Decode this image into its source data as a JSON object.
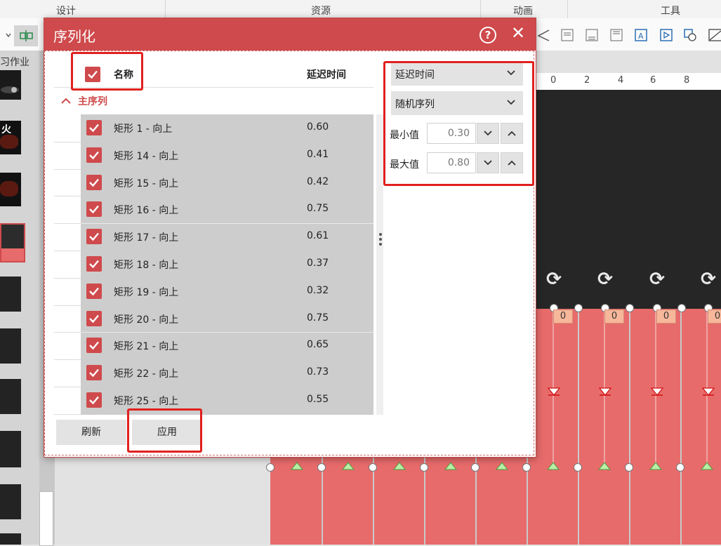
{
  "ribbon": {
    "tabs": [
      "设计",
      "资源",
      "动画",
      "工具"
    ]
  },
  "left_pane": {
    "label": "习作业",
    "thumb_text": "火"
  },
  "ruler": {
    "ticks": [
      "0",
      "2",
      "4",
      "6",
      "8"
    ]
  },
  "slide": {
    "handle_value": "0"
  },
  "dialog": {
    "title": "序列化",
    "help_symbol": "?",
    "close_symbol": "✕",
    "header": {
      "name": "名称",
      "delay": "延迟时间",
      "all_checked": true
    },
    "group": {
      "label": "主序列",
      "expanded": true
    },
    "rows": [
      {
        "name": "矩形 1 - 向上",
        "delay": "0.60",
        "checked": true
      },
      {
        "name": "矩形 14 - 向上",
        "delay": "0.41",
        "checked": true
      },
      {
        "name": "矩形 15 - 向上",
        "delay": "0.42",
        "checked": true
      },
      {
        "name": "矩形 16 - 向上",
        "delay": "0.75",
        "checked": true
      },
      {
        "name": "矩形 17 - 向上",
        "delay": "0.61",
        "checked": true
      },
      {
        "name": "矩形 18 - 向上",
        "delay": "0.37",
        "checked": true
      },
      {
        "name": "矩形 19 - 向上",
        "delay": "0.32",
        "checked": true
      },
      {
        "name": "矩形 20 - 向上",
        "delay": "0.75",
        "checked": true
      },
      {
        "name": "矩形 21 - 向上",
        "delay": "0.65",
        "checked": true
      },
      {
        "name": "矩形 22 - 向上",
        "delay": "0.73",
        "checked": true
      },
      {
        "name": "矩形 25 - 向上",
        "delay": "0.55",
        "checked": true
      }
    ],
    "options": {
      "property_dropdown": "延迟时间",
      "order_dropdown": "随机序列",
      "min_label": "最小值",
      "min_value": "0.30",
      "max_label": "最大值",
      "max_value": "0.80"
    },
    "buttons": {
      "refresh": "刷新",
      "apply": "应用"
    }
  },
  "colors": {
    "accent": "#cf4a4c",
    "highlight": "#e0201e",
    "slide_red": "#e86b6b",
    "slide_dark": "#262626"
  }
}
